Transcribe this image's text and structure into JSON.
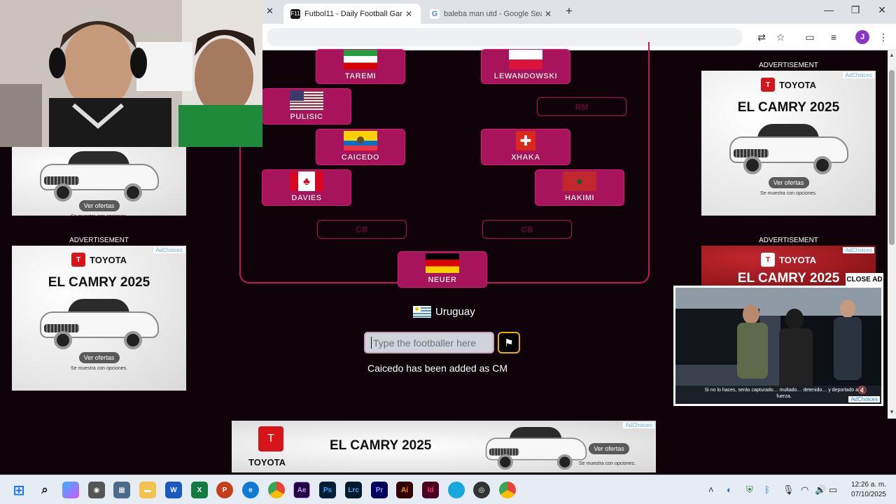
{
  "browser": {
    "tabs": [
      {
        "title": "Futbol11 - Daily Football Game",
        "favicon": "F11",
        "active": true
      },
      {
        "title": "baleba man utd - Google Search",
        "favicon": "G",
        "active": false
      }
    ],
    "new_tab_label": "+",
    "close_label": "✕"
  },
  "game": {
    "players": [
      {
        "id": "taremi",
        "name": "TAREMI",
        "flag": "iran-flag"
      },
      {
        "id": "lewandowski",
        "name": "LEWANDOWSKI",
        "flag": "poland-flag"
      },
      {
        "id": "pulisic",
        "name": "PULISIC",
        "flag": "usa-flag"
      },
      {
        "id": "caicedo",
        "name": "CAICEDO",
        "flag": "ecuador-flag"
      },
      {
        "id": "xhaka",
        "name": "XHAKA",
        "flag": "switzerland-flag"
      },
      {
        "id": "davies",
        "name": "DAVIES",
        "flag": "canada-flag"
      },
      {
        "id": "hakimi",
        "name": "HAKIMI",
        "flag": "morocco-flag"
      },
      {
        "id": "neuer",
        "name": "NEUER",
        "flag": "germany-flag"
      }
    ],
    "empty_slots": {
      "rm": "RM",
      "cb_left": "CB",
      "cb_right": "CB"
    },
    "current_nation": "Uruguay",
    "search_placeholder": "Type the footballer here",
    "status_message": "Caicedo has been added as CM"
  },
  "ads": {
    "label": "ADVERTISEMENT",
    "adchoices": "AdChoices",
    "brand": "TOYOTA",
    "headline": "EL CAMRY 2025",
    "cta": "Ver ofertas",
    "fine_print": "Se muestra con opciones.",
    "close_ad": "CLOSE AD",
    "video_caption": "Si no lo haces, serás capturado… multado… detenido… y deportado a la fuerza."
  },
  "taskbar": {
    "time": "12:26 a. m.",
    "date": "07/10/2025"
  }
}
